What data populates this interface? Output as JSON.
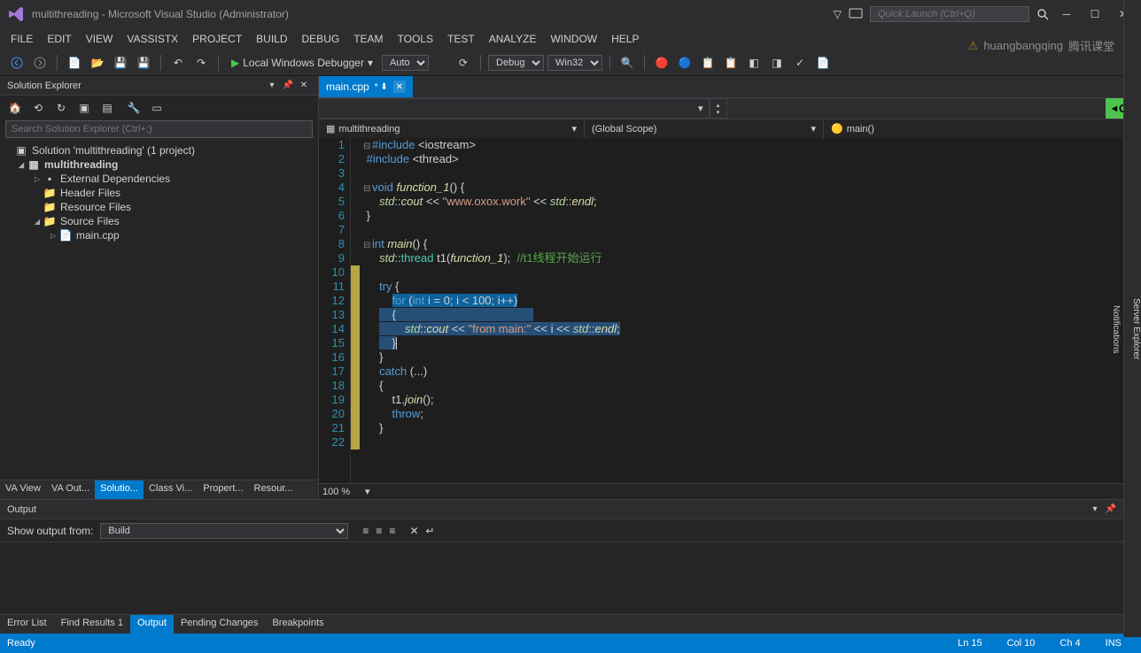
{
  "titlebar": {
    "title": "multithreading - Microsoft Visual Studio (Administrator)",
    "quick_launch_placeholder": "Quick Launch (Ctrl+Q)"
  },
  "menubar": [
    "FILE",
    "EDIT",
    "VIEW",
    "VASSISTX",
    "PROJECT",
    "BUILD",
    "DEBUG",
    "TEAM",
    "TOOLS",
    "TEST",
    "ANALYZE",
    "WINDOW",
    "HELP"
  ],
  "toolbar": {
    "debug_label": "Local Windows Debugger",
    "config_auto": "Auto",
    "config_debug": "Debug",
    "config_platform": "Win32"
  },
  "solution_explorer": {
    "title": "Solution Explorer",
    "search_placeholder": "Search Solution Explorer (Ctrl+;)",
    "solution_label": "Solution 'multithreading' (1 project)",
    "project": "multithreading",
    "folders": {
      "external": "External Dependencies",
      "header": "Header Files",
      "resource": "Resource Files",
      "source": "Source Files"
    },
    "file": "main.cpp",
    "tabs": [
      "VA View",
      "VA Out...",
      "Solutio...",
      "Class Vi...",
      "Propert...",
      "Resour..."
    ]
  },
  "editor": {
    "tab_name": "main.cpp",
    "nav_dropdown": "",
    "go_label": "Go",
    "crumb_project": "multithreading",
    "crumb_scope": "(Global Scope)",
    "crumb_func": "main()",
    "zoom": "100 %"
  },
  "code": {
    "l1a": "#include ",
    "l1b": "<iostream>",
    "l2a": "#include ",
    "l2b": "<thread>",
    "l4a": "void",
    "l4b": "function_1",
    "l4c": "() {",
    "l5a": "std",
    "l5b": "cout",
    "l5c": " << ",
    "l5d": "\"www.oxox.work\"",
    "l5e": " << ",
    "l5f": "std",
    "l5g": "endl",
    "l5h": ";",
    "l6": "}",
    "l8a": "int",
    "l8b": "main",
    "l8c": "() {",
    "l9a": "std",
    "l9b": "thread",
    "l9c": " t1(",
    "l9d": "function_1",
    "l9e": ");  ",
    "l9f": "//t1线程开始运行",
    "l11a": "try",
    "l11b": " {",
    "l12a": "for",
    "l12b": " (",
    "l12c": "int",
    "l12d": " i = 0; i < 100; i++)",
    "l13": "{",
    "l14a": "std",
    "l14b": "cout",
    "l14c": " << ",
    "l14d": "\"from main:\"",
    "l14e": " << i << ",
    "l14f": "std",
    "l14g": "endl",
    "l14h": ";",
    "l15": "}",
    "l16": "}",
    "l17a": "catch",
    "l17b": " (...)",
    "l18": "{",
    "l19a": "t1.",
    "l19b": "join",
    "l19c": "();",
    "l20a": "throw",
    "l20b": ";",
    "l21": "}"
  },
  "output": {
    "title": "Output",
    "show_from_label": "Show output from:",
    "show_from_value": "Build"
  },
  "bottom_tabs": [
    "Error List",
    "Find Results 1",
    "Output",
    "Pending Changes",
    "Breakpoints"
  ],
  "statusbar": {
    "ready": "Ready",
    "line": "Ln 15",
    "col": "Col 10",
    "ch": "Ch 4",
    "ins": "INS"
  },
  "overlay_user": "huangbangqing",
  "overlay_brand": "腾讯课堂",
  "right_rail": [
    "Server Explorer",
    "Notifications"
  ]
}
